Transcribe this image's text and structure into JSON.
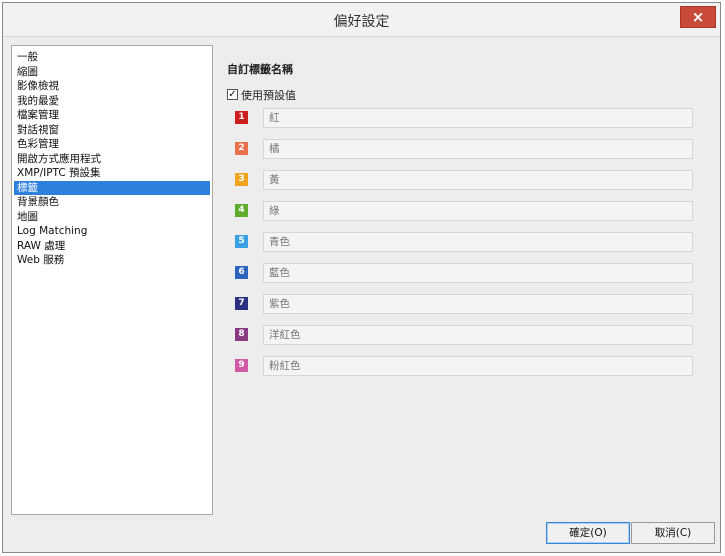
{
  "window": {
    "title": "偏好設定",
    "close_label": "×"
  },
  "sidebar": {
    "items": [
      {
        "label": "一般"
      },
      {
        "label": "縮圖"
      },
      {
        "label": "影像檢視"
      },
      {
        "label": "我的最愛"
      },
      {
        "label": "檔案管理"
      },
      {
        "label": "對話視窗"
      },
      {
        "label": "色彩管理"
      },
      {
        "label": "開啟方式應用程式"
      },
      {
        "label": "XMP/IPTC 預設集"
      },
      {
        "label": "標籤",
        "selected": true
      },
      {
        "label": "背景顏色"
      },
      {
        "label": "地圖"
      },
      {
        "label": "Log Matching"
      },
      {
        "label": "RAW 處理"
      },
      {
        "label": "Web 服務"
      }
    ]
  },
  "main": {
    "section_title": "自訂標籤名稱",
    "use_default_label": "使用預設值",
    "use_default_checked": true,
    "checkmark": "✓",
    "labels": [
      {
        "num": "1",
        "name": "紅",
        "color": "#cc1e1e"
      },
      {
        "num": "2",
        "name": "橘",
        "color": "#e8704a"
      },
      {
        "num": "3",
        "name": "黃",
        "color": "#efa520"
      },
      {
        "num": "4",
        "name": "綠",
        "color": "#5eab2d"
      },
      {
        "num": "5",
        "name": "青色",
        "color": "#3aa2e2"
      },
      {
        "num": "6",
        "name": "藍色",
        "color": "#2b63bd"
      },
      {
        "num": "7",
        "name": "紫色",
        "color": "#2b2f82"
      },
      {
        "num": "8",
        "name": "洋紅色",
        "color": "#8a3a82"
      },
      {
        "num": "9",
        "name": "粉紅色",
        "color": "#cf5aa5"
      }
    ]
  },
  "buttons": {
    "ok": "確定(O)",
    "cancel": "取消(C)"
  }
}
